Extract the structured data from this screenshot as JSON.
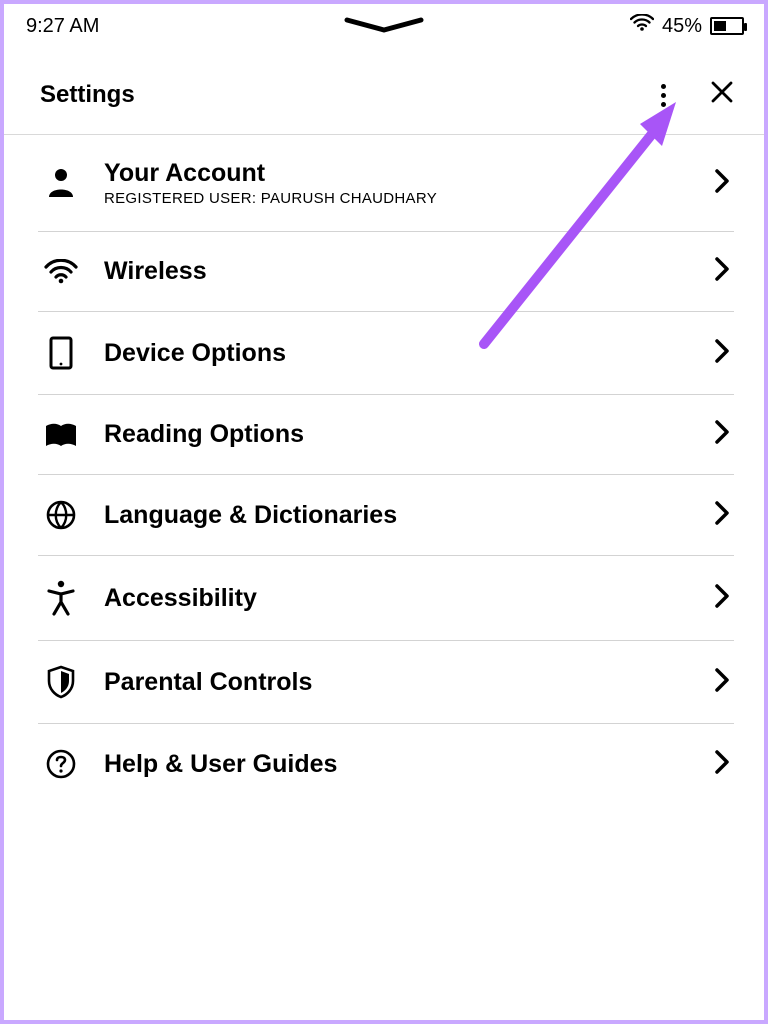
{
  "status": {
    "time": "9:27 AM",
    "battery_pct": "45%"
  },
  "header": {
    "title": "Settings"
  },
  "rows": {
    "account": {
      "title": "Your Account",
      "sub": "REGISTERED USER: PAURUSH CHAUDHARY"
    },
    "wireless": {
      "title": "Wireless"
    },
    "device": {
      "title": "Device Options"
    },
    "reading": {
      "title": "Reading Options"
    },
    "language": {
      "title": "Language & Dictionaries"
    },
    "accessibility": {
      "title": "Accessibility"
    },
    "parental": {
      "title": "Parental Controls"
    },
    "help": {
      "title": "Help & User Guides"
    }
  }
}
